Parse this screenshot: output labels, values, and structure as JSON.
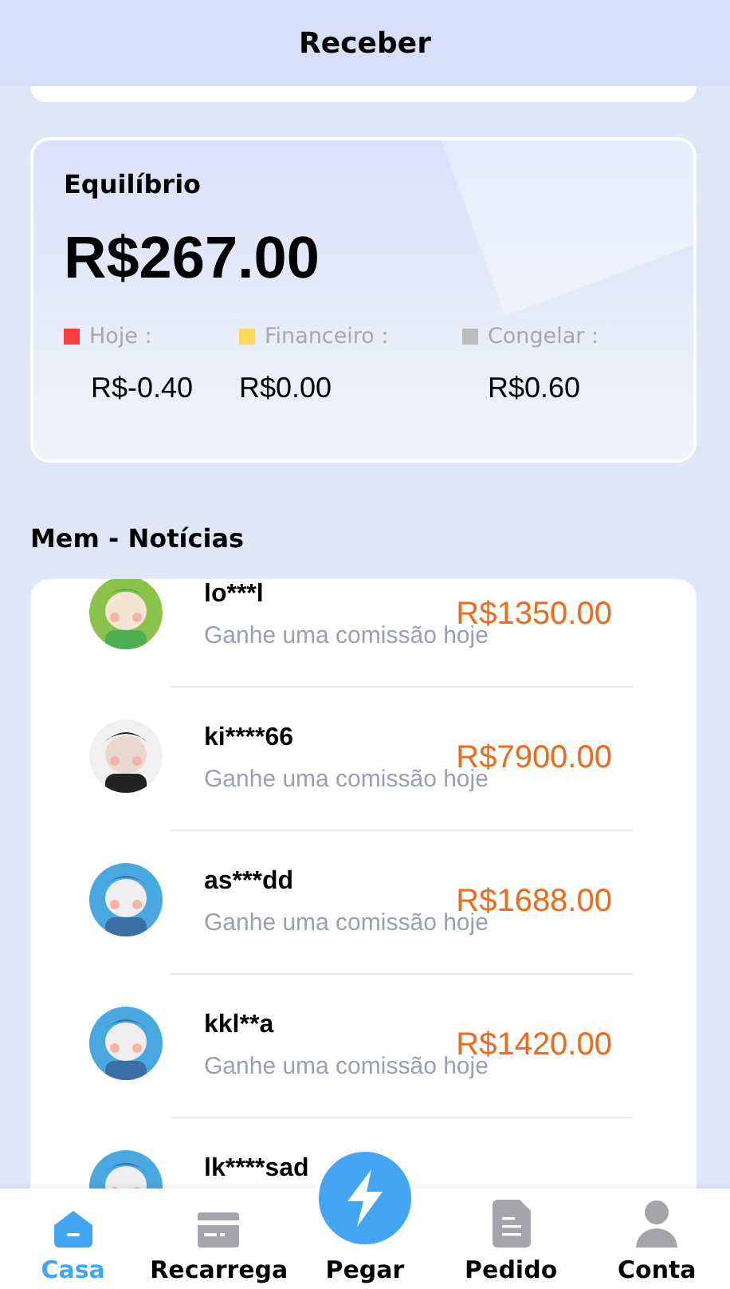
{
  "header": {
    "title": "Receber"
  },
  "balance": {
    "title": "Equilíbrio",
    "amount": "R$267.00",
    "stats": [
      {
        "label": "Hoje :",
        "value": "R$-0.40",
        "color": "#ff3b3b"
      },
      {
        "label": "Financeiro :",
        "value": "R$0.00",
        "color": "#ffd95a"
      },
      {
        "label": "Congelar :",
        "value": "R$0.60",
        "color": "#bdbdbd"
      }
    ]
  },
  "news": {
    "title": "Mem - Notícias",
    "items": [
      {
        "name": "lo***l",
        "text": "Ganhe uma comissão hoje",
        "amount": "R$1350.00"
      },
      {
        "name": "ki****66",
        "text": "Ganhe uma comissão hoje",
        "amount": "R$7900.00"
      },
      {
        "name": "as***dd",
        "text": "Ganhe uma comissão hoje",
        "amount": "R$1688.00"
      },
      {
        "name": "kkl**a",
        "text": "Ganhe uma comissão hoje",
        "amount": "R$1420.00"
      },
      {
        "name": "lk****sad"
      }
    ]
  },
  "nav": [
    {
      "kind": "home",
      "label": "Casa",
      "selected": true
    },
    {
      "kind": "card",
      "label": "Recarrega",
      "selected": false
    },
    {
      "kind": "bolt",
      "label": "Pegar",
      "selected": false
    },
    {
      "kind": "doc",
      "label": "Pedido",
      "selected": false
    },
    {
      "kind": "user",
      "label": "Conta",
      "selected": false
    }
  ]
}
